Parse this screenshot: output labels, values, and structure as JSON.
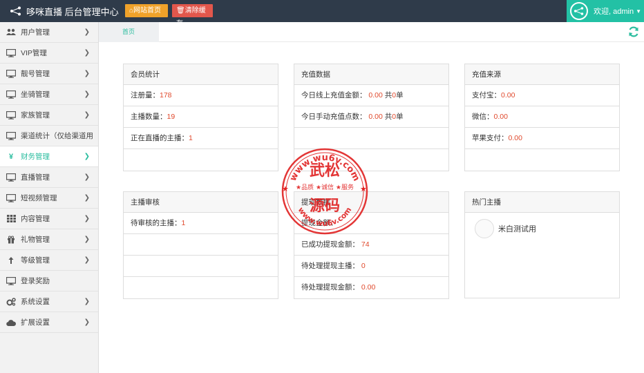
{
  "header": {
    "title": "哆咪直播 后台管理中心",
    "home_button": "网站首页",
    "clear_button": "清除缓存",
    "user_label": "欢迎, admin"
  },
  "sidebar": {
    "items": [
      {
        "label": "用户管理",
        "icon": "users-icon",
        "chevron": true
      },
      {
        "label": "VIP管理",
        "icon": "monitor-icon",
        "chevron": true
      },
      {
        "label": "靓号管理",
        "icon": "monitor-icon",
        "chevron": true
      },
      {
        "label": "坐骑管理",
        "icon": "monitor-icon",
        "chevron": true
      },
      {
        "label": "家族管理",
        "icon": "monitor-icon",
        "chevron": true
      },
      {
        "label": "渠道统计（仅给渠道用",
        "icon": "monitor-icon",
        "chevron": false
      },
      {
        "label": "财务管理",
        "icon": "yen-icon",
        "chevron": true,
        "active": true
      },
      {
        "label": "直播管理",
        "icon": "monitor-icon",
        "chevron": true
      },
      {
        "label": "短视频管理",
        "icon": "monitor-icon",
        "chevron": true
      },
      {
        "label": "内容管理",
        "icon": "grid-icon",
        "chevron": true
      },
      {
        "label": "礼物管理",
        "icon": "gift-icon",
        "chevron": true
      },
      {
        "label": "等级管理",
        "icon": "level-icon",
        "chevron": true
      },
      {
        "label": "登录奖励",
        "icon": "monitor-icon",
        "chevron": false
      },
      {
        "label": "系统设置",
        "icon": "gears-icon",
        "chevron": true
      },
      {
        "label": "扩展设置",
        "icon": "cloud-icon",
        "chevron": true
      }
    ]
  },
  "tabs": {
    "home": "首页"
  },
  "panels": {
    "member": {
      "title": "会员统计",
      "registered_label": "注册量：",
      "registered_value": "178",
      "anchors_label": "主播数量：",
      "anchors_value": "19",
      "live_label": "正在直播的主播：",
      "live_value": "1"
    },
    "recharge": {
      "title": "充值数据",
      "online_label": "今日线上充值金额：",
      "online_value": "0.00",
      "online_mid": " 共",
      "online_count": "0",
      "online_unit": "单",
      "manual_label": "今日手动充值点数：",
      "manual_value": "0.00",
      "manual_mid": " 共",
      "manual_count": "0",
      "manual_unit": "单"
    },
    "source": {
      "title": "充值来源",
      "alipay_label": "支付宝：",
      "alipay_value": "0.00",
      "wechat_label": "微信：",
      "wechat_value": "0.00",
      "apple_label": "苹果支付：",
      "apple_value": "0.00"
    },
    "review": {
      "title": "主播审核",
      "pending_label": "待审核的主播：",
      "pending_value": "1"
    },
    "withdraw": {
      "title": "提现数据",
      "amount_label": "提现金额：",
      "success_label": "已成功提现金额：",
      "success_value": "74",
      "pending_anchor_label": "待处理提现主播：",
      "pending_anchor_value": "0",
      "pending_amount_label": "待处理提现金额：",
      "pending_amount_value": "0.00"
    },
    "hot": {
      "title": "热门主播",
      "anchor_name": "米白测试用"
    }
  },
  "watermark": {
    "top_text": "www.wu6v.com",
    "main1": "武松",
    "tagline": "★品质 ★诚信 ★服务",
    "main2": "源码",
    "bottom_text": "www.wu6v.com",
    "color": "#e02020"
  },
  "colors": {
    "topbar": "#2f3b4a",
    "accent": "#2bbd9f",
    "user_area": "#23c1a5",
    "home_btn": "#f0a22a",
    "clear_btn": "#e2574c",
    "value": "#e0492c"
  }
}
